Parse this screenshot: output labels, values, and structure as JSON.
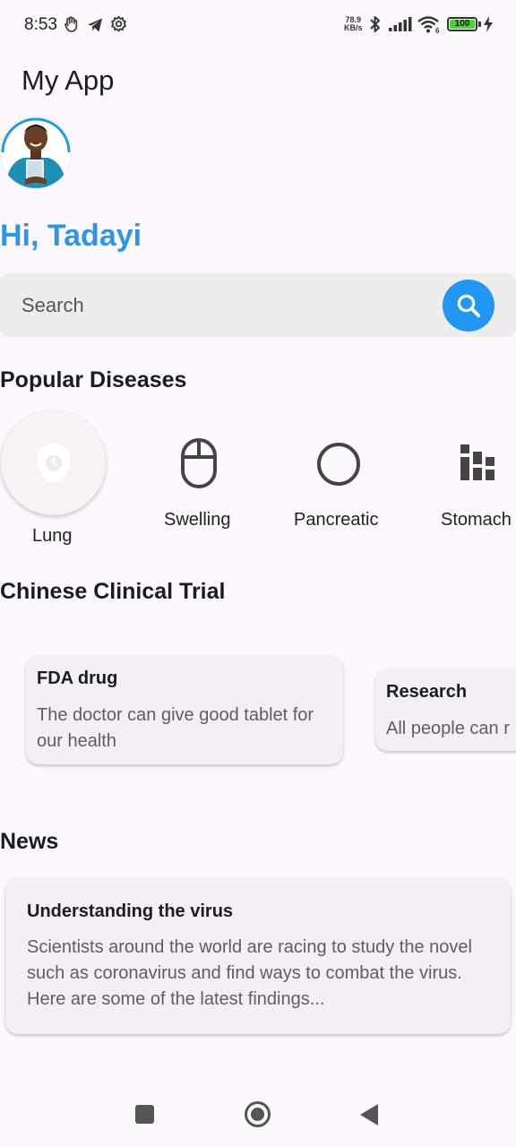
{
  "status_bar": {
    "time": "8:53",
    "net_speed_value": "78.9",
    "net_speed_unit": "KB/s",
    "battery": "100",
    "wifi_badge": "6"
  },
  "app_title": "My App",
  "greeting": "Hi, Tadayi",
  "search": {
    "placeholder": "Search",
    "icon": "search-icon"
  },
  "popular_diseases": {
    "title": "Popular Diseases",
    "items": [
      {
        "label": "Lung",
        "icon": "shield-clock-icon",
        "selected": true
      },
      {
        "label": "Swelling",
        "icon": "mouse-icon"
      },
      {
        "label": "Pancreatic",
        "icon": "circle-icon"
      },
      {
        "label": "Stomach",
        "icon": "bar-chart-icon"
      }
    ]
  },
  "clinical_trial": {
    "title": "Chinese Clinical Trial",
    "cards": [
      {
        "title": "FDA drug",
        "body": "The doctor can give good tablet for our health"
      },
      {
        "title": "Research",
        "body": "All people can r"
      }
    ]
  },
  "news": {
    "title": "News",
    "items": [
      {
        "title": "Understanding the virus",
        "body": "Scientists around the world are racing to study the novel such as coronavirus and find ways to combat the virus. Here are some of the latest findings..."
      }
    ]
  },
  "colors": {
    "accent": "#2196f3",
    "greeting": "#2e96e8",
    "background": "#fdf8fd",
    "card": "#f4eff4"
  },
  "nav": {
    "recents": "square-icon",
    "home": "circle-home-icon",
    "back": "triangle-back-icon"
  }
}
